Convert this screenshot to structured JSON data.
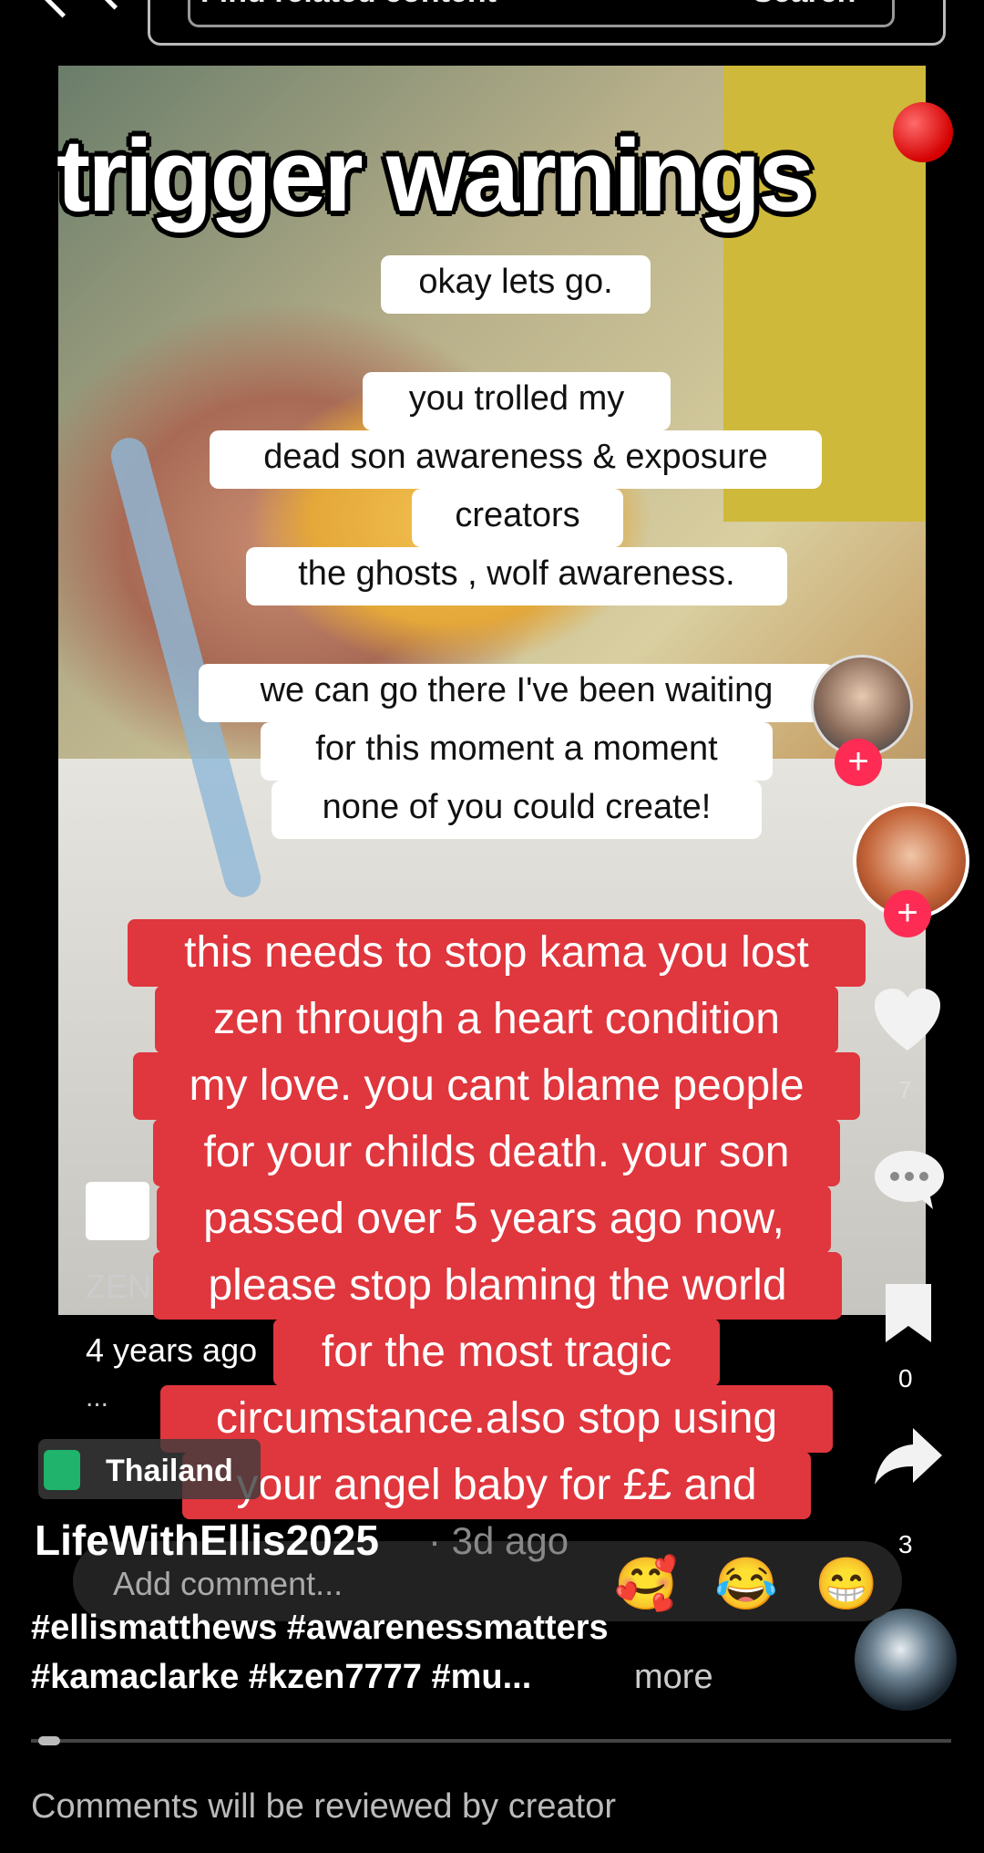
{
  "search": {
    "placeholder": "Find related content",
    "button": "Search"
  },
  "video": {
    "title": "trigger warnings",
    "white_captions": [
      "okay lets go.",
      "you trolled my",
      "dead son awareness & exposure",
      "creators",
      "the ghosts , wolf awareness.",
      "we can go there I've been waiting",
      "for this moment a moment",
      "none of you could create!"
    ],
    "red_caption_lines": [
      "this needs to stop kama you lost",
      "zen through a heart condition",
      "my love. you cant blame people",
      "for your childs death. your son",
      "passed over 5 years ago now,",
      "please stop blaming the world",
      "for the most tragic",
      "circumstance.also stop using",
      "your angel baby for ££ and"
    ],
    "inner_account": "ZEN",
    "inner_time": "4 years ago",
    "inner_dots": "..."
  },
  "right_rail": {
    "follow_plus": "+",
    "like_count": "7",
    "bookmark_count": "0",
    "share_count": "3",
    "progress": 0.02
  },
  "location": {
    "label": "Thailand"
  },
  "post": {
    "author": "LifeWithEllis2025",
    "time": "· 3d ago",
    "hashtags_line1": "#ellismatthews #awarenessmatters",
    "hashtags_line2": "#kamaclarke #kzen7777 #mu...",
    "more_label": "more"
  },
  "comment": {
    "placeholder": "Add comment...",
    "quick_emojis": [
      "🥰",
      "😂",
      "😁"
    ]
  },
  "footer": {
    "review_notice": "Comments will be reviewed by creator"
  },
  "colors": {
    "accent": "#fe2c55",
    "caption_red": "#e0363d",
    "background": "#000000"
  }
}
